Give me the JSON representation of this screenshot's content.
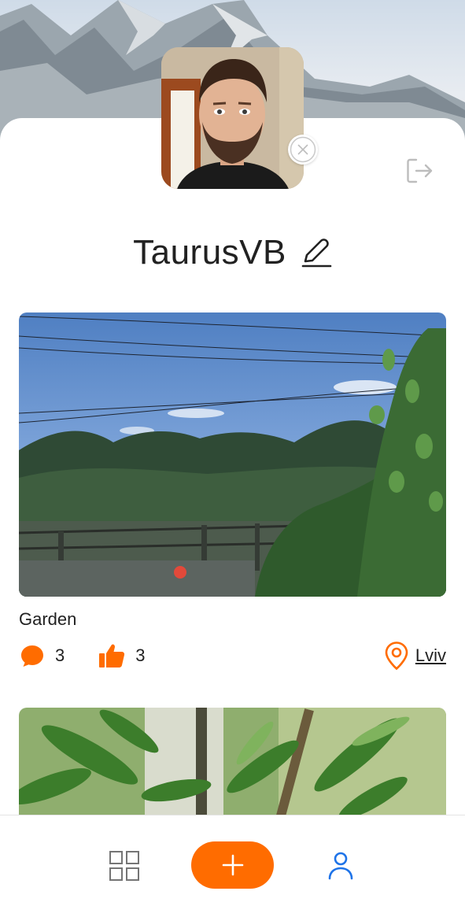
{
  "profile": {
    "username": "TaurusVB"
  },
  "post": {
    "title": "Garden",
    "comments_count": "3",
    "likes_count": "3",
    "location": "Lviv"
  },
  "icons": {
    "remove_avatar": "close-circle-icon",
    "logout": "logout-icon",
    "edit": "pencil-icon",
    "comment": "comment-bubble-icon",
    "like": "thumbs-up-icon",
    "location": "map-pin-icon",
    "grid": "grid-icon",
    "add": "plus-icon",
    "profile": "user-icon"
  },
  "colors": {
    "accent": "#FF6C00",
    "active_tab": "#1E73E8",
    "text": "#212121",
    "muted_icon": "#BDBDBD"
  }
}
